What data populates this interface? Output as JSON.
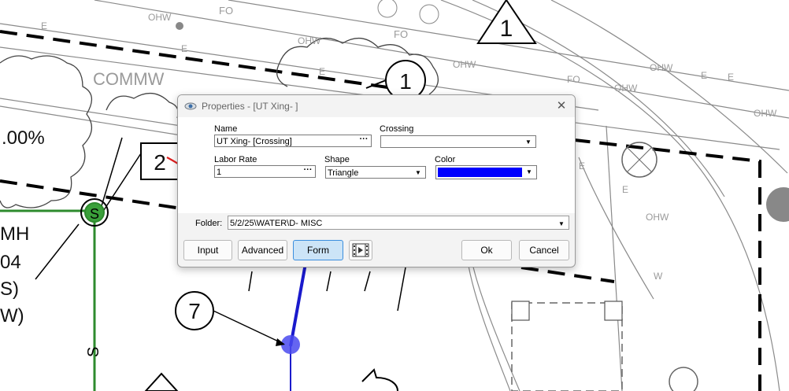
{
  "background": {
    "map_labels": [
      "FO",
      "OHW",
      "E",
      "OHW",
      "FO",
      "E",
      "E",
      "FO",
      "OHW",
      "OHW",
      "E",
      "FO",
      "OHW",
      "E",
      "OHW",
      "E",
      "E",
      "OHW",
      "W",
      "COMMW"
    ],
    "callouts": [
      "1",
      "1",
      "2",
      "7"
    ],
    "left_texts": [
      ".00%",
      "MH",
      "04",
      "S)",
      "W)"
    ],
    "s_label": "S"
  },
  "dialog": {
    "title": "Properties - [UT Xing- ]",
    "close_glyph": "✕",
    "name_label": "Name",
    "name_value": "UT Xing- [Crossing]",
    "crossing_label": "Crossing",
    "crossing_value": "",
    "labor_rate_label": "Labor Rate",
    "labor_rate_value": "1",
    "shape_label": "Shape",
    "shape_value": "Triangle",
    "color_label": "Color",
    "color_value": "#0000ff",
    "ellipsis": "···",
    "dropdown_glyph": "▼",
    "folder_label": "Folder:",
    "folder_value": "5/2/25\\WATER\\D- MISC",
    "buttons": {
      "input": "Input",
      "advanced": "Advanced",
      "form": "Form",
      "ok": "Ok",
      "cancel": "Cancel"
    }
  }
}
